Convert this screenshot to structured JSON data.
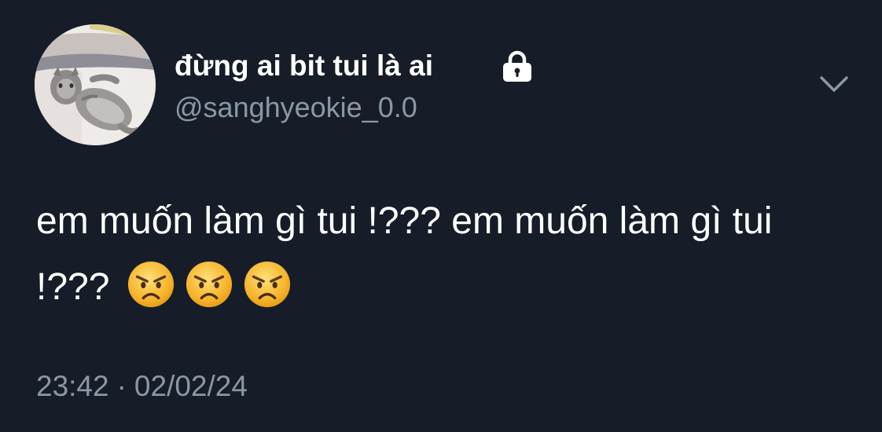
{
  "user": {
    "display_name": "đừng ai bit tui là ai",
    "handle": "@sanghyeokie_0.0",
    "protected_icon": "lock-icon",
    "avatar": "cat-photo"
  },
  "tweet": {
    "text": "em muốn làm gì tui !??? em muốn làm gì tui !???",
    "emojis": [
      "angry-face-emoji",
      "angry-face-emoji",
      "angry-face-emoji"
    ],
    "time": "23:42",
    "separator": "·",
    "date": "02/02/24"
  },
  "menu": {
    "icon": "chevron-down-icon"
  },
  "colors": {
    "background": "#161d28",
    "text": "#ffffff",
    "muted": "#8a98a6",
    "emoji_face": "#f7b731"
  }
}
